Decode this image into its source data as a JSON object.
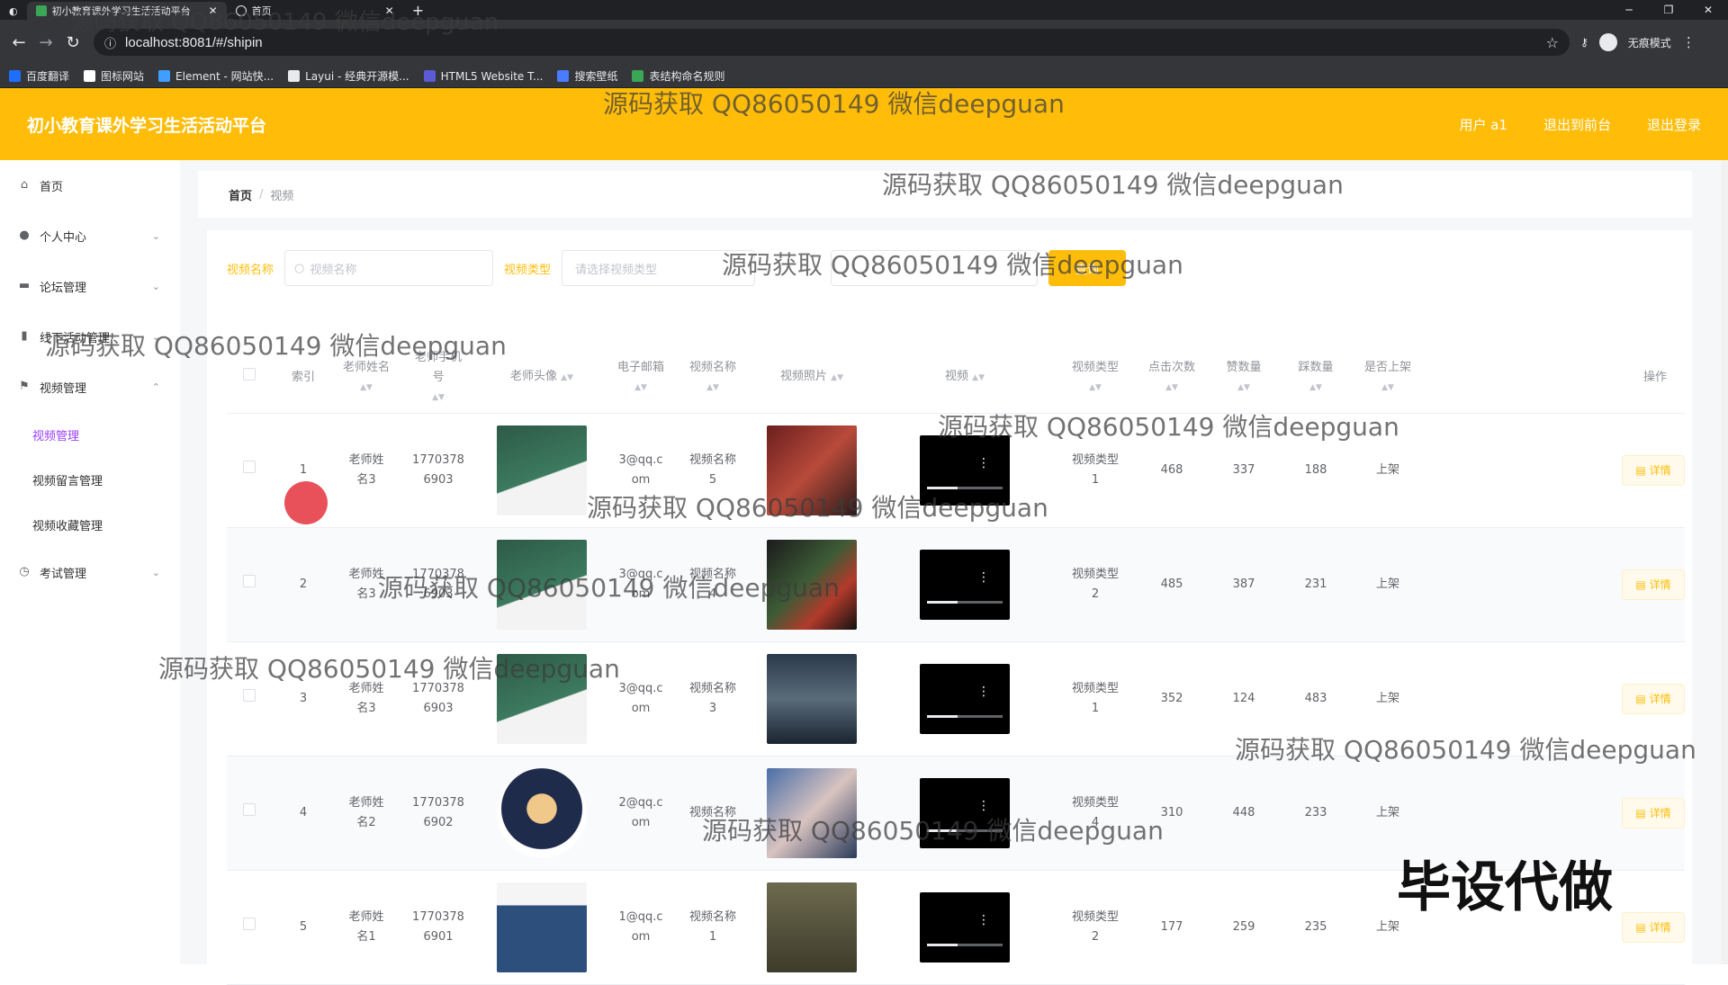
{
  "browser": {
    "tabs": [
      {
        "label": "初小教育课外学习生活活动平台",
        "active": true
      },
      {
        "label": "首页",
        "active": false
      }
    ],
    "url": "localhost:8081/#/shipin",
    "incognito_label": "无痕模式",
    "bookmarks": [
      {
        "label": "百度翻译",
        "color": "#1e6fff"
      },
      {
        "label": "图标网站",
        "color": "#ffffff"
      },
      {
        "label": "Element - 网站快...",
        "color": "#409eff"
      },
      {
        "label": "Layui - 经典开源模...",
        "color": "#e8eaed"
      },
      {
        "label": "HTML5 Website T...",
        "color": "#5b5bd6"
      },
      {
        "label": "搜索壁纸",
        "color": "#4a7cff"
      },
      {
        "label": "表结构命名规则",
        "color": "#3aa757"
      }
    ]
  },
  "header": {
    "title": "初小教育课外学习生活活动平台",
    "links": [
      "用户 a1",
      "退出到前台",
      "退出登录"
    ],
    "color": "#ffbd0a"
  },
  "sidebar": {
    "items": [
      {
        "label": "首页",
        "icon": "home-icon",
        "expandable": false
      },
      {
        "label": "个人中心",
        "icon": "user-icon",
        "expandable": true
      },
      {
        "label": "论坛管理",
        "icon": "briefcase-icon",
        "expandable": true
      },
      {
        "label": "线下活动管理",
        "icon": "book-icon",
        "expandable": true
      },
      {
        "label": "视频管理",
        "icon": "flag-icon",
        "expandable": true,
        "expanded": true
      }
    ],
    "subitems": [
      {
        "label": "视频管理",
        "active": true
      },
      {
        "label": "视频留言管理",
        "active": false
      },
      {
        "label": "视频收藏管理",
        "active": false
      }
    ],
    "last_item": {
      "label": "考试管理",
      "icon": "clock-icon"
    },
    "active_color": "#9a3fff"
  },
  "breadcrumb": {
    "home": "首页",
    "separator": "/",
    "current": "视频"
  },
  "search": {
    "name_label": "视频名称",
    "name_placeholder": "视频名称",
    "type_label": "视频类型",
    "type_placeholder": "请选择视频类型",
    "button_label": "查询"
  },
  "table": {
    "headers": {
      "index": "索引",
      "teacher_name": "老师姓名",
      "teacher_phone": "老师手机号",
      "teacher_avatar": "老师头像",
      "email": "电子邮箱",
      "video_name": "视频名称",
      "video_photo": "视频照片",
      "video": "视频",
      "video_type": "视频类型",
      "clicks": "点击次数",
      "likes": "赞数量",
      "dislikes": "踩数量",
      "on_shelf": "是否上架",
      "actions": "操作"
    },
    "detail_label": "详情",
    "rows": [
      {
        "index": "1",
        "name": "老师姓名3",
        "phone": "17703786903",
        "email": "3@qq.com",
        "vname": "视频名称5",
        "vtype": "视频类型1",
        "clicks": "468",
        "likes": "337",
        "dislikes": "188",
        "status": "上架"
      },
      {
        "index": "2",
        "name": "老师姓名3",
        "phone": "17703786903",
        "email": "3@qq.com",
        "vname": "视频名称4",
        "vtype": "视频类型2",
        "clicks": "485",
        "likes": "387",
        "dislikes": "231",
        "status": "上架"
      },
      {
        "index": "3",
        "name": "老师姓名3",
        "phone": "17703786903",
        "email": "3@qq.com",
        "vname": "视频名称3",
        "vtype": "视频类型1",
        "clicks": "352",
        "likes": "124",
        "dislikes": "483",
        "status": "上架"
      },
      {
        "index": "4",
        "name": "老师姓名2",
        "phone": "17703786902",
        "email": "2@qq.com",
        "vname": "视频名称",
        "vtype": "视频类型4",
        "clicks": "310",
        "likes": "448",
        "dislikes": "233",
        "status": "上架"
      },
      {
        "index": "5",
        "name": "老师姓名1",
        "phone": "17703786901",
        "email": "1@qq.com",
        "vname": "视频名称1",
        "vtype": "视频类型2",
        "clicks": "177",
        "likes": "259",
        "dislikes": "235",
        "status": "上架"
      }
    ]
  },
  "watermark_text": "源码获取 QQ86050149 微信deepguan",
  "stamp_text": "毕设代做"
}
